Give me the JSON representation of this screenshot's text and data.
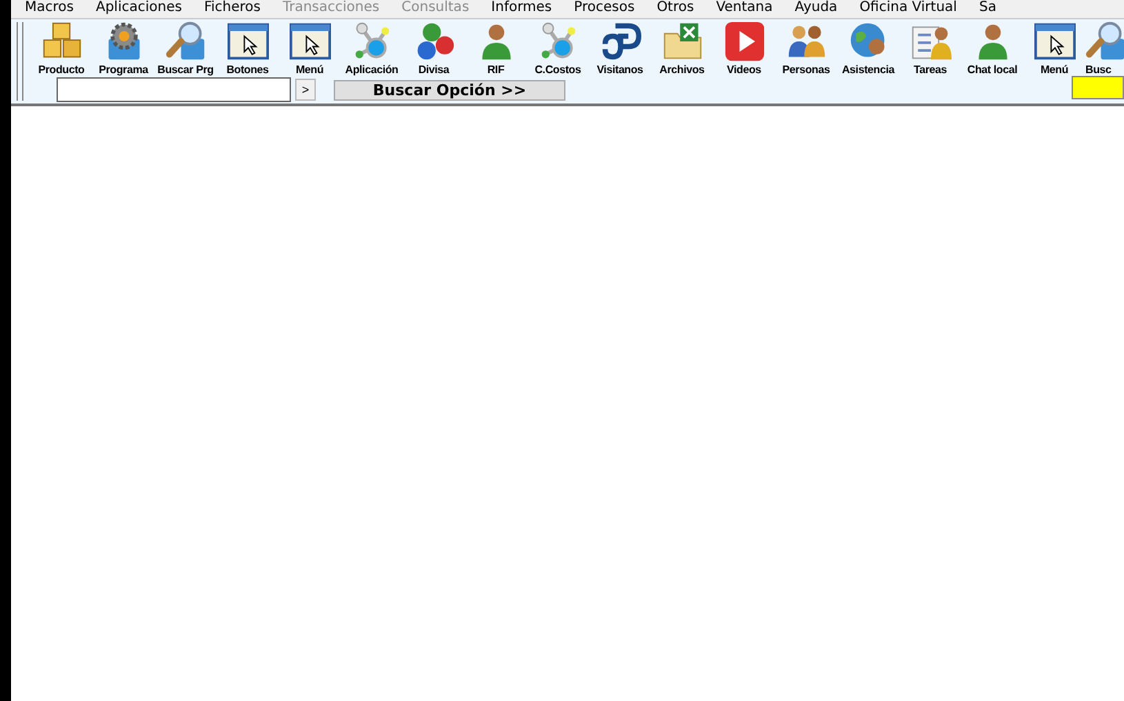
{
  "menu_bar": [
    {
      "label": "Macros",
      "disabled": false
    },
    {
      "label": "Aplicaciones",
      "disabled": false
    },
    {
      "label": "Ficheros",
      "disabled": false
    },
    {
      "label": "Transacciones",
      "disabled": true
    },
    {
      "label": "Consultas",
      "disabled": true
    },
    {
      "label": "Informes",
      "disabled": false
    },
    {
      "label": "Procesos",
      "disabled": false
    },
    {
      "label": "Otros",
      "disabled": false
    },
    {
      "label": "Ventana",
      "disabled": false
    },
    {
      "label": "Ayuda",
      "disabled": false
    },
    {
      "label": "Oficina Virtual",
      "disabled": false
    },
    {
      "label": "Sa",
      "disabled": false
    }
  ],
  "toolbar": [
    {
      "label": "Producto"
    },
    {
      "label": "Programa"
    },
    {
      "label": "Buscar Prg"
    },
    {
      "label": "Botones"
    },
    {
      "label": "Menú"
    },
    {
      "label": "Aplicación"
    },
    {
      "label": "Divisa"
    },
    {
      "label": "RIF"
    },
    {
      "label": "C.Costos"
    },
    {
      "label": "Visitanos"
    },
    {
      "label": "Archivos"
    },
    {
      "label": "Videos"
    },
    {
      "label": "Personas"
    },
    {
      "label": "Asistencia"
    },
    {
      "label": "Tareas"
    },
    {
      "label": "Chat local"
    },
    {
      "label": "Menú"
    },
    {
      "label": "Busc"
    }
  ],
  "search_bar": {
    "go_button": ">",
    "search_button": "Buscar Opción >>"
  }
}
